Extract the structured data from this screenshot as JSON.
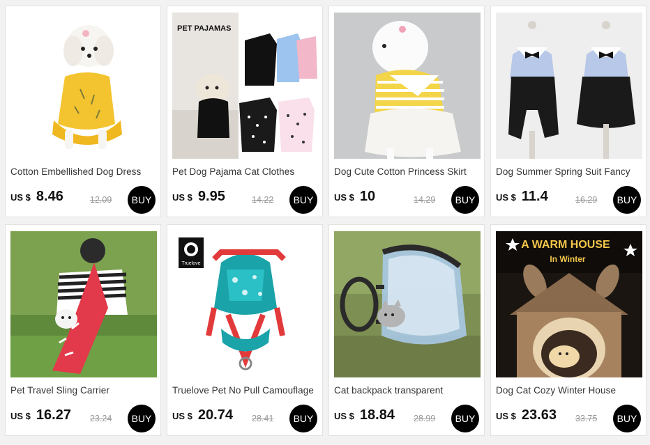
{
  "accent_color": "#000000",
  "currency_label": "US $",
  "buy_label": "BUY",
  "products": [
    {
      "title": "Cotton Embellished Dog Dress",
      "price": "8.46",
      "old_price": "12.09",
      "image": "dog-yellow-dress-image"
    },
    {
      "title": "Pet Dog Pajama Cat Clothes",
      "price": "9.95",
      "old_price": "14.22",
      "image": "dog-pajamas-image",
      "image_text": "PET PAJAMAS"
    },
    {
      "title": "Dog Cute Cotton Princess Skirt",
      "price": "10",
      "old_price": "14.29",
      "image": "dog-princess-skirt-image"
    },
    {
      "title": "Dog Summer Spring Suit Fancy",
      "price": "11.4",
      "old_price": "16.29",
      "image": "dog-suit-image"
    },
    {
      "title": "Pet Travel Sling Carrier",
      "price": "16.27",
      "old_price": "23.24",
      "image": "sling-carrier-image"
    },
    {
      "title": "Truelove Pet No Pull Camouflage",
      "price": "20.74",
      "old_price": "28.41",
      "image": "harness-image",
      "image_text": "Truelove"
    },
    {
      "title": "Cat backpack transparent",
      "price": "18.84",
      "old_price": "28.99",
      "image": "cat-backpack-image"
    },
    {
      "title": "Dog Cat Cozy Winter House",
      "price": "23.63",
      "old_price": "33.75",
      "image": "winter-house-image",
      "image_text": "A WARM HOUSE",
      "image_subtext": "In Winter"
    }
  ]
}
